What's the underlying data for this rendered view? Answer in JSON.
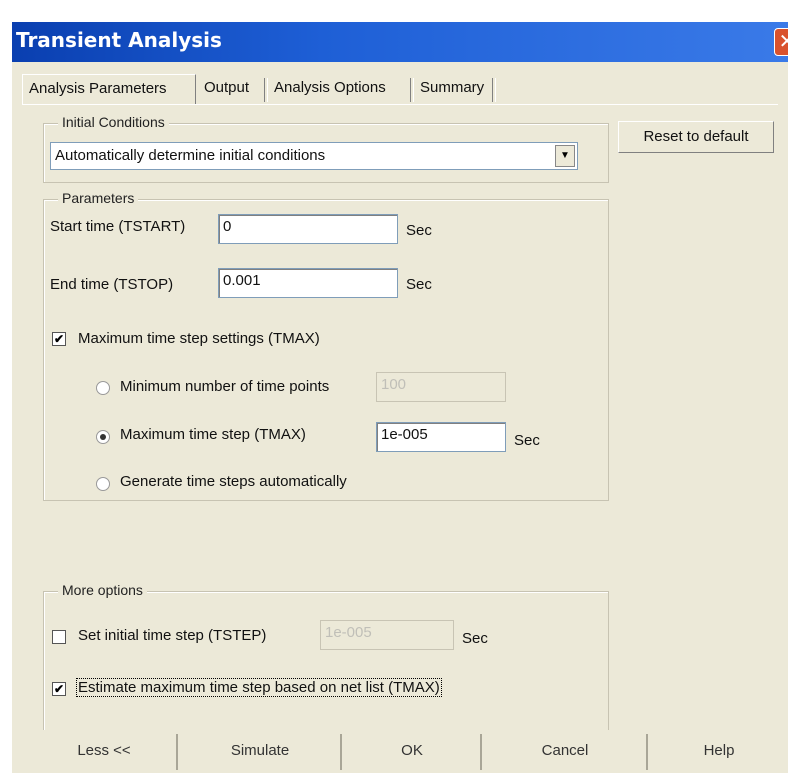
{
  "window": {
    "title": "Transient Analysis",
    "close_glyph": "✕"
  },
  "tabs": [
    {
      "label": "Analysis Parameters",
      "active": true
    },
    {
      "label": "Output",
      "active": false
    },
    {
      "label": "Analysis Options",
      "active": false
    },
    {
      "label": "Summary",
      "active": false
    }
  ],
  "initial_conditions": {
    "group_label": "Initial Conditions",
    "selected": "Automatically determine initial conditions",
    "dropdown_glyph": "▼"
  },
  "reset_button": {
    "label": "Reset to default"
  },
  "parameters": {
    "group_label": "Parameters",
    "start_time": {
      "label": "Start time (TSTART)",
      "value": "0",
      "unit": "Sec"
    },
    "end_time": {
      "label": "End time (TSTOP)",
      "value": "0.001",
      "unit": "Sec"
    },
    "tmax_settings": {
      "label": "Maximum time step settings (TMAX)",
      "checked": true,
      "check_glyph": "✔"
    },
    "radio_min_points": {
      "label": "Minimum number of time points",
      "value": "100",
      "selected": false
    },
    "radio_max_step": {
      "label": "Maximum time step (TMAX)",
      "value": "1e-005",
      "unit": "Sec",
      "selected": true
    },
    "radio_auto": {
      "label": "Generate time steps automatically",
      "selected": false
    }
  },
  "more_options": {
    "group_label": "More options",
    "initial_step": {
      "label": "Set initial time step (TSTEP)",
      "value": "1e-005",
      "unit": "Sec",
      "checked": false
    },
    "estimate_step": {
      "label": "Estimate maximum time step based on net list (TMAX)",
      "checked": true,
      "check_glyph": "✔"
    }
  },
  "bottom_buttons": {
    "less": "Less <<",
    "simulate": "Simulate",
    "ok": "OK",
    "cancel": "Cancel",
    "help": "Help"
  },
  "colors": {
    "title_bar": "#1e5fd6",
    "dialog_bg": "#ece9d8",
    "close_button": "#d9522d"
  }
}
